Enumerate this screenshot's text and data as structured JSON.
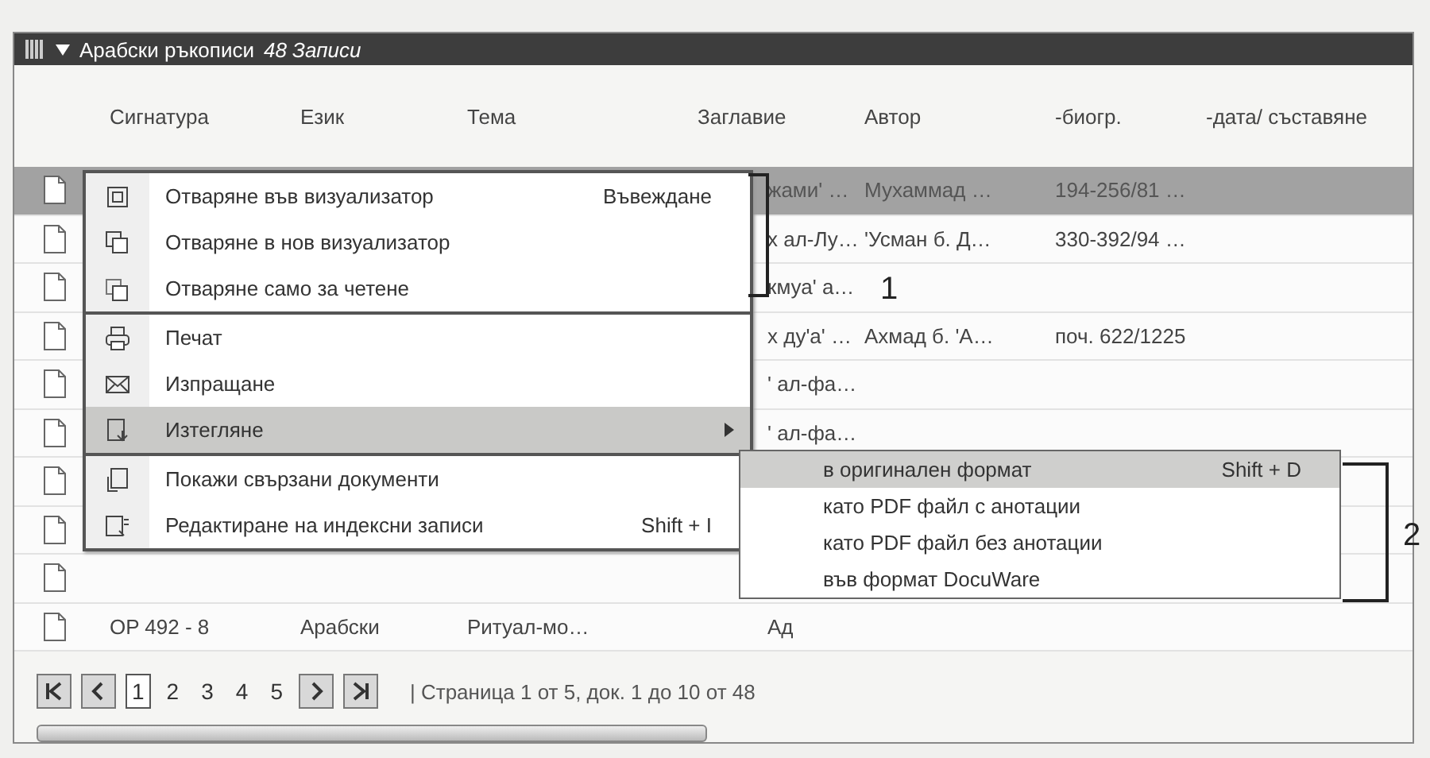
{
  "title_bar": {
    "title": "Арабски ръкописи",
    "count": "48 Записи",
    "expanded": true
  },
  "columns": [
    "Сигнатура",
    "Език",
    "Тема",
    "Заглавие",
    "Автор",
    "-биогр.",
    "-дата/ съставяне"
  ],
  "rows": [
    {
      "selected": true,
      "cells": {
        "3": "жами' …",
        "4": "Мухаммад …",
        "5": "194-256/81 …"
      }
    },
    {
      "selected": false,
      "cells": {
        "3": "х ал-Лу…",
        "4": "'Усман б. Д…",
        "5": "330-392/94 …"
      }
    },
    {
      "selected": false,
      "cells": {
        "3": "кмуа' а…"
      }
    },
    {
      "selected": false,
      "cells": {
        "3": "х ду'а' …",
        "4": "Ахмад б. 'А…",
        "5": "поч. 622/1225"
      }
    },
    {
      "selected": false,
      "cells": {
        "3": "' ал-фа…"
      }
    },
    {
      "selected": false,
      "cells": {
        "3": "' ал-фа…"
      }
    },
    {
      "selected": false,
      "cells": {}
    },
    {
      "selected": false,
      "cells": {}
    },
    {
      "selected": false,
      "cells": {}
    },
    {
      "selected": false,
      "cells": {
        "0": "OP 492 - 8",
        "1": "Арабски",
        "2": "Ритуал-мо…",
        "3": "Ад"
      }
    }
  ],
  "context_menu": {
    "groups": [
      [
        {
          "kind": "open",
          "label": "Отваряне във визуализатор",
          "shortcut": "Въвеждане",
          "selected": false,
          "submenu": false
        },
        {
          "kind": "open-new",
          "label": "Отваряне в нов визуализатор",
          "selected": false,
          "submenu": false
        },
        {
          "kind": "open-readonly",
          "label": "Отваряне само за четене",
          "selected": false,
          "submenu": false
        }
      ],
      [
        {
          "kind": "print",
          "label": "Печат",
          "selected": false,
          "submenu": false
        },
        {
          "kind": "send",
          "label": "Изпращане",
          "selected": false,
          "submenu": false
        },
        {
          "kind": "download",
          "label": "Изтегляне",
          "selected": true,
          "submenu": true
        }
      ],
      [
        {
          "kind": "related",
          "label": "Покажи свързани документи",
          "selected": false,
          "submenu": false
        },
        {
          "kind": "edit",
          "label": "Редактиране на индексни записи",
          "shortcut": "Shift + I",
          "selected": false,
          "submenu": false
        }
      ]
    ]
  },
  "submenu": [
    {
      "label": "в оригинален формат",
      "shortcut": "Shift + D",
      "selected": true
    },
    {
      "label": "като PDF файл с анотации",
      "selected": false
    },
    {
      "label": "като PDF файл без анотации",
      "selected": false
    },
    {
      "label": "във формат DocuWare",
      "selected": false
    }
  ],
  "pagination": {
    "pages": [
      {
        "label": "1",
        "selected": true
      },
      {
        "label": "2",
        "selected": false
      },
      {
        "label": "3",
        "selected": false
      },
      {
        "label": "4",
        "selected": false
      },
      {
        "label": "5",
        "selected": false
      }
    ],
    "status": "| Страница 1 от 5, док. 1 до 10 от 48"
  },
  "callouts": [
    "1",
    "2"
  ]
}
